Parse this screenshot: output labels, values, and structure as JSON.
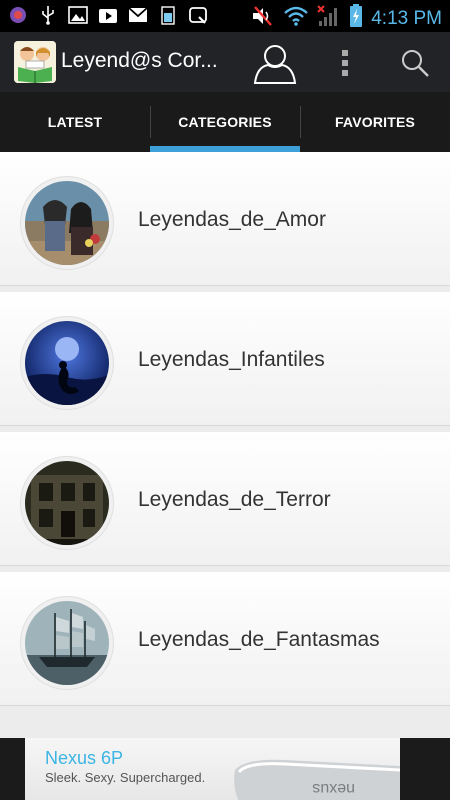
{
  "status_bar": {
    "time": "4:13 PM",
    "left_icons": [
      "app-icon",
      "usb-icon",
      "image-icon",
      "play-store-icon",
      "gmail-icon",
      "storage-icon",
      "quickmemo-icon"
    ],
    "right_icons": [
      "muted-icon",
      "wifi-icon",
      "no-signal-icon",
      "battery-charging-icon"
    ]
  },
  "app_bar": {
    "title": "Leyend@s Cor...",
    "user_icon": "user-icon",
    "menu_icon": "overflow-menu-icon",
    "search_icon": "search-icon"
  },
  "tabs": [
    {
      "label": "LATEST",
      "active": false
    },
    {
      "label": "CATEGORIES",
      "active": true
    },
    {
      "label": "FAVORITES",
      "active": false
    }
  ],
  "categories": [
    {
      "label": "Leyendas_de_Amor",
      "thumb": "couple-thumbnail"
    },
    {
      "label": "Leyendas_Infantiles",
      "thumb": "mermaid-thumbnail"
    },
    {
      "label": "Leyendas_de_Terror",
      "thumb": "haunted-house-thumbnail"
    },
    {
      "label": "Leyendas_de_Fantasmas",
      "thumb": "ghost-ship-thumbnail"
    }
  ],
  "ad": {
    "title": "Nexus 6P",
    "subtitle": "Sleek. Sexy. Supercharged.",
    "phone_text": "nexus"
  },
  "colors": {
    "accent": "#3ea0d8",
    "appbar": "#222326",
    "tabs": "#1a1a1a",
    "time": "#59b8e8"
  }
}
